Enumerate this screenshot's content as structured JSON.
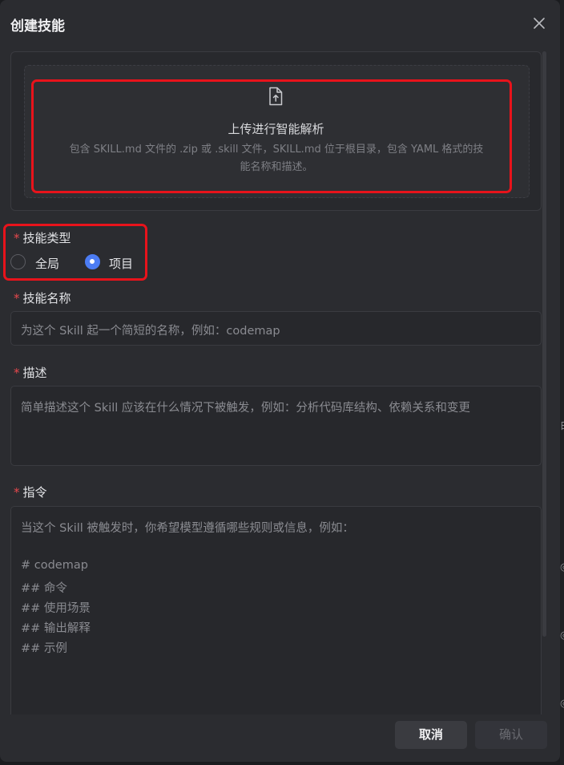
{
  "dialog": {
    "title": "创建技能",
    "close_icon": "close-icon"
  },
  "upload": {
    "icon": "file-upload-icon",
    "title": "上传进行智能解析",
    "description_line1": "包含 SKILL.md 文件的 .zip 或 .skill 文件，SKILL.md 位于根目录，包含 YAML 格式的技",
    "description_line2": "能名称和描述。"
  },
  "skill_type": {
    "required_mark": "*",
    "label": "技能类型",
    "options": [
      {
        "label": "全局",
        "selected": false
      },
      {
        "label": "项目",
        "selected": true
      }
    ]
  },
  "skill_name": {
    "required_mark": "*",
    "label": "技能名称",
    "placeholder": "为这个 Skill 起一个简短的名称，例如：codemap",
    "value": ""
  },
  "description": {
    "required_mark": "*",
    "label": "描述",
    "placeholder": "简单描述这个 Skill 应该在什么情况下被触发，例如：分析代码库结构、依赖关系和变更",
    "value": ""
  },
  "instruction": {
    "required_mark": "*",
    "label": "指令",
    "placeholder_lines": [
      "当这个 Skill 被触发时，你希望模型遵循哪些规则或信息，例如：",
      "",
      "# codemap",
      "## 命令",
      "## 使用场景",
      "## 输出解释",
      "## 示例"
    ]
  },
  "footer": {
    "cancel_label": "取消",
    "confirm_label": "确认"
  },
  "colors": {
    "accent": "#4c7cf3",
    "required": "#e5484d",
    "highlight": "#e8131b"
  }
}
